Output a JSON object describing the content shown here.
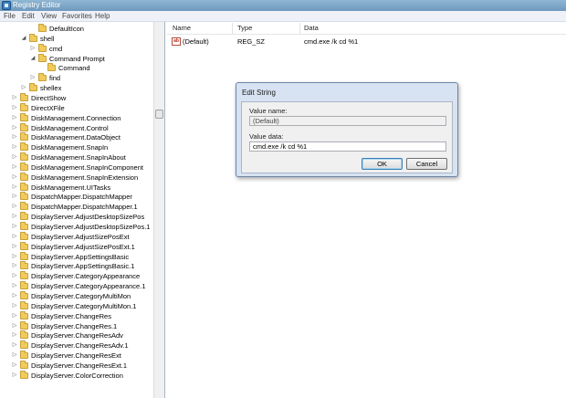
{
  "window": {
    "title": "Registry Editor"
  },
  "menu": [
    "File",
    "Edit",
    "View",
    "Favorites",
    "Help"
  ],
  "tree": [
    {
      "label": "DefaultIcon",
      "indent": 3,
      "expander": ""
    },
    {
      "label": "shell",
      "indent": 2,
      "expander": "open"
    },
    {
      "label": "cmd",
      "indent": 3,
      "expander": "closed"
    },
    {
      "label": "Command Prompt",
      "indent": 3,
      "expander": "open"
    },
    {
      "label": "Command",
      "indent": 4,
      "expander": ""
    },
    {
      "label": "find",
      "indent": 3,
      "expander": "closed"
    },
    {
      "label": "shellex",
      "indent": 2,
      "expander": "closed"
    },
    {
      "label": "DirectShow",
      "indent": 1,
      "expander": "closed"
    },
    {
      "label": "DirectXFile",
      "indent": 1,
      "expander": "closed"
    },
    {
      "label": "DiskManagement.Connection",
      "indent": 1,
      "expander": "closed"
    },
    {
      "label": "DiskManagement.Control",
      "indent": 1,
      "expander": "closed"
    },
    {
      "label": "DiskManagement.DataObject",
      "indent": 1,
      "expander": "closed"
    },
    {
      "label": "DiskManagement.SnapIn",
      "indent": 1,
      "expander": "closed"
    },
    {
      "label": "DiskManagement.SnapInAbout",
      "indent": 1,
      "expander": "closed"
    },
    {
      "label": "DiskManagement.SnapInComponent",
      "indent": 1,
      "expander": "closed"
    },
    {
      "label": "DiskManagement.SnapInExtension",
      "indent": 1,
      "expander": "closed"
    },
    {
      "label": "DiskManagement.UITasks",
      "indent": 1,
      "expander": "closed"
    },
    {
      "label": "DispatchMapper.DispatchMapper",
      "indent": 1,
      "expander": "closed"
    },
    {
      "label": "DispatchMapper.DispatchMapper.1",
      "indent": 1,
      "expander": "closed"
    },
    {
      "label": "DisplayServer.AdjustDesktopSizePos",
      "indent": 1,
      "expander": "closed"
    },
    {
      "label": "DisplayServer.AdjustDesktopSizePos.1",
      "indent": 1,
      "expander": "closed"
    },
    {
      "label": "DisplayServer.AdjustSizePosExt",
      "indent": 1,
      "expander": "closed"
    },
    {
      "label": "DisplayServer.AdjustSizePosExt.1",
      "indent": 1,
      "expander": "closed"
    },
    {
      "label": "DisplayServer.AppSettingsBasic",
      "indent": 1,
      "expander": "closed"
    },
    {
      "label": "DisplayServer.AppSettingsBasic.1",
      "indent": 1,
      "expander": "closed"
    },
    {
      "label": "DisplayServer.CategoryAppearance",
      "indent": 1,
      "expander": "closed"
    },
    {
      "label": "DisplayServer.CategoryAppearance.1",
      "indent": 1,
      "expander": "closed"
    },
    {
      "label": "DisplayServer.CategoryMultiMon",
      "indent": 1,
      "expander": "closed"
    },
    {
      "label": "DisplayServer.CategoryMultiMon.1",
      "indent": 1,
      "expander": "closed"
    },
    {
      "label": "DisplayServer.ChangeRes",
      "indent": 1,
      "expander": "closed"
    },
    {
      "label": "DisplayServer.ChangeRes.1",
      "indent": 1,
      "expander": "closed"
    },
    {
      "label": "DisplayServer.ChangeResAdv",
      "indent": 1,
      "expander": "closed"
    },
    {
      "label": "DisplayServer.ChangeResAdv.1",
      "indent": 1,
      "expander": "closed"
    },
    {
      "label": "DisplayServer.ChangeResExt",
      "indent": 1,
      "expander": "closed"
    },
    {
      "label": "DisplayServer.ChangeResExt.1",
      "indent": 1,
      "expander": "closed"
    },
    {
      "label": "DisplayServer.ColorCorrection",
      "indent": 1,
      "expander": "closed"
    }
  ],
  "list": {
    "columns": {
      "name": "Name",
      "type": "Type",
      "data": "Data"
    },
    "rows": [
      {
        "name": "(Default)",
        "type": "REG_SZ",
        "data": "cmd.exe /k cd %1"
      }
    ]
  },
  "dialog": {
    "title": "Edit String",
    "value_name_label": "Value name:",
    "value_name": "(Default)",
    "value_data_label": "Value data:",
    "value_data": "cmd.exe /k cd %1",
    "ok_label": "OK",
    "cancel_label": "Cancel"
  }
}
